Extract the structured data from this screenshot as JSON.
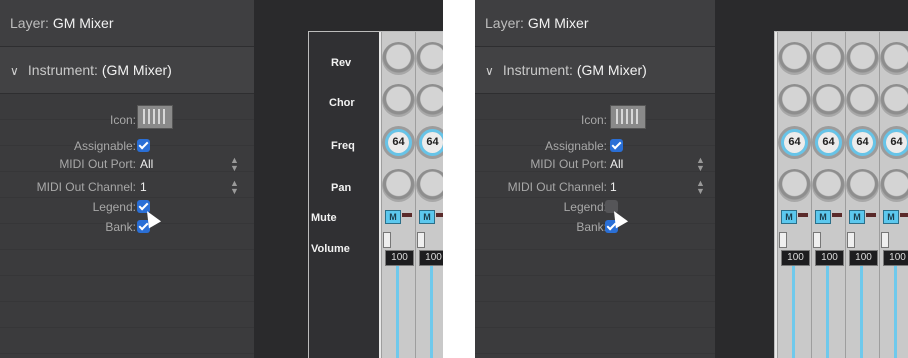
{
  "layer": {
    "label": "Layer:",
    "name": "GM Mixer"
  },
  "instrument": {
    "label": "Instrument:",
    "name": "(GM Mixer)"
  },
  "props": {
    "icon_label": "Icon:",
    "assignable_label": "Assignable:",
    "midi_out_port_label": "MIDI Out Port:",
    "midi_out_port_value": "All",
    "midi_out_channel_label": "MIDI Out Channel:",
    "midi_out_channel_value": "1",
    "legend_label": "Legend:",
    "bank_label": "Bank:"
  },
  "panels": [
    {
      "legend_checked": true,
      "assignable_checked": true,
      "bank_checked": true
    },
    {
      "legend_checked": false,
      "assignable_checked": true,
      "bank_checked": true
    }
  ],
  "mixer": {
    "row_labels": [
      "Rev",
      "Chor",
      "Freq",
      "Pan",
      "Mute",
      "Volume"
    ],
    "freq_value": "64",
    "mute_label": "M",
    "volume_value": "100"
  },
  "colors": {
    "accent": "#2a6fd6",
    "knob_ring": "#67c4e8",
    "mute": "#5cc8ee"
  }
}
